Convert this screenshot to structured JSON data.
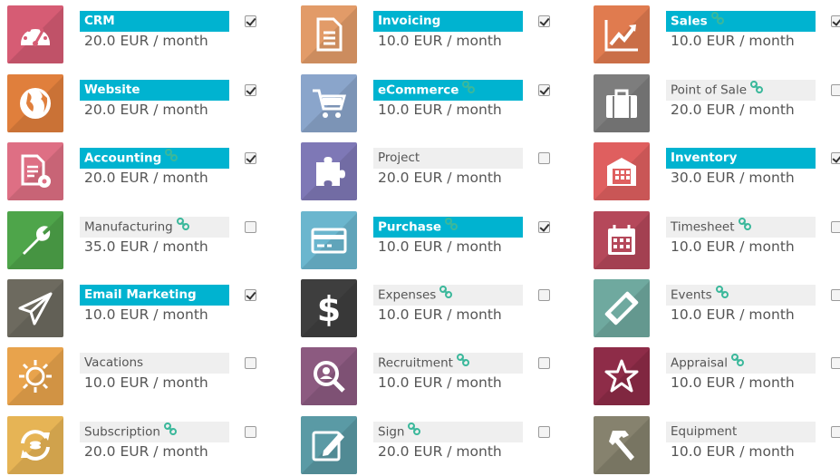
{
  "apps": [
    {
      "name": "CRM",
      "price": "20.0 EUR / month",
      "selected": true,
      "link": false,
      "icon": "gauge-icon",
      "color": "#d65c74"
    },
    {
      "name": "Invoicing",
      "price": "10.0 EUR / month",
      "selected": true,
      "link": false,
      "icon": "document-icon",
      "color": "#e29b68"
    },
    {
      "name": "Sales",
      "price": "10.0 EUR / month",
      "selected": true,
      "link": true,
      "icon": "trend-chart-icon",
      "color": "#e07b4f"
    },
    {
      "name": "Website",
      "price": "20.0 EUR / month",
      "selected": true,
      "link": false,
      "icon": "globe-icon",
      "color": "#e07f3c"
    },
    {
      "name": "eCommerce",
      "price": "10.0 EUR / month",
      "selected": true,
      "link": true,
      "icon": "cart-icon",
      "color": "#8aa5cb"
    },
    {
      "name": "Point of Sale",
      "price": "20.0 EUR / month",
      "selected": false,
      "link": true,
      "icon": "briefcase-icon",
      "color": "#7d7d7d"
    },
    {
      "name": "Accounting",
      "price": "20.0 EUR / month",
      "selected": true,
      "link": true,
      "icon": "invoice-gear-icon",
      "color": "#de6f84"
    },
    {
      "name": "Project",
      "price": "20.0 EUR / month",
      "selected": false,
      "link": false,
      "icon": "puzzle-icon",
      "color": "#7e78b6"
    },
    {
      "name": "Inventory",
      "price": "30.0 EUR / month",
      "selected": true,
      "link": false,
      "icon": "warehouse-icon",
      "color": "#df5f5f"
    },
    {
      "name": "Manufacturing",
      "price": "35.0 EUR / month",
      "selected": false,
      "link": true,
      "icon": "wrench-icon",
      "color": "#4ea54a"
    },
    {
      "name": "Purchase",
      "price": "10.0 EUR / month",
      "selected": true,
      "link": true,
      "icon": "credit-card-icon",
      "color": "#6bb6ce"
    },
    {
      "name": "Timesheet",
      "price": "10.0 EUR / month",
      "selected": false,
      "link": true,
      "icon": "calendar-icon",
      "color": "#b5485a"
    },
    {
      "name": "Email Marketing",
      "price": "10.0 EUR / month",
      "selected": true,
      "link": false,
      "icon": "paper-plane-icon",
      "color": "#6d6a5f"
    },
    {
      "name": "Expenses",
      "price": "10.0 EUR / month",
      "selected": false,
      "link": true,
      "icon": "dollar-icon",
      "color": "#3e3e3e"
    },
    {
      "name": "Events",
      "price": "10.0 EUR / month",
      "selected": false,
      "link": true,
      "icon": "ticket-icon",
      "color": "#6fa99f"
    },
    {
      "name": "Vacations",
      "price": "10.0 EUR / month",
      "selected": false,
      "link": false,
      "icon": "sun-icon",
      "color": "#e8a34c"
    },
    {
      "name": "Recruitment",
      "price": "10.0 EUR / month",
      "selected": false,
      "link": true,
      "icon": "magnifier-icon",
      "color": "#8c5a80"
    },
    {
      "name": "Appraisal",
      "price": "10.0 EUR / month",
      "selected": false,
      "link": true,
      "icon": "star-icon",
      "color": "#8e2c48"
    },
    {
      "name": "Subscription",
      "price": "20.0 EUR / month",
      "selected": false,
      "link": true,
      "icon": "refresh-icon",
      "color": "#e6b455"
    },
    {
      "name": "Sign",
      "price": "20.0 EUR / month",
      "selected": false,
      "link": true,
      "icon": "signature-icon",
      "color": "#5a9aa5"
    },
    {
      "name": "Equipment",
      "price": "10.0 EUR / month",
      "selected": false,
      "link": false,
      "icon": "hammer-icon",
      "color": "#86826e"
    }
  ]
}
